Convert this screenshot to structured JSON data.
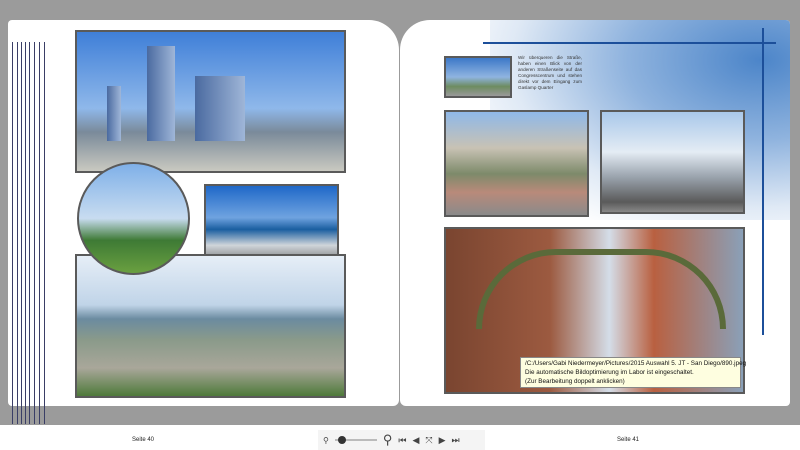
{
  "left_page": {
    "label": "Seite 40"
  },
  "right_page": {
    "label": "Seite 41",
    "caption": "Wir überqueren die Straße, haben einen Blick von der anderen Straßenseite auf das Congresscentrum und stehen direkt vor dem Eingang zum Gaslamp Quarter"
  },
  "tooltip": {
    "line1": "/C:/Users/Gabi Niedermeyer/Pictures/2015 Auswahl 5. JT - San Diego/890.jpeg",
    "line2": "Die automatische Bildoptimierung im Labor ist eingeschaltet.",
    "line3": "(Zur Bearbeitung doppelt anklicken)"
  },
  "toolbar": {
    "zoom_out": "zoom-out-icon",
    "zoom_in": "zoom-in-icon",
    "zoom_level": 0.1,
    "first": "⏮",
    "prev": "◀",
    "fit": "⤧",
    "next": "▶",
    "last": "⏭"
  },
  "colors": {
    "accent": "#1c4f9a",
    "background": "#9b9b9b"
  }
}
